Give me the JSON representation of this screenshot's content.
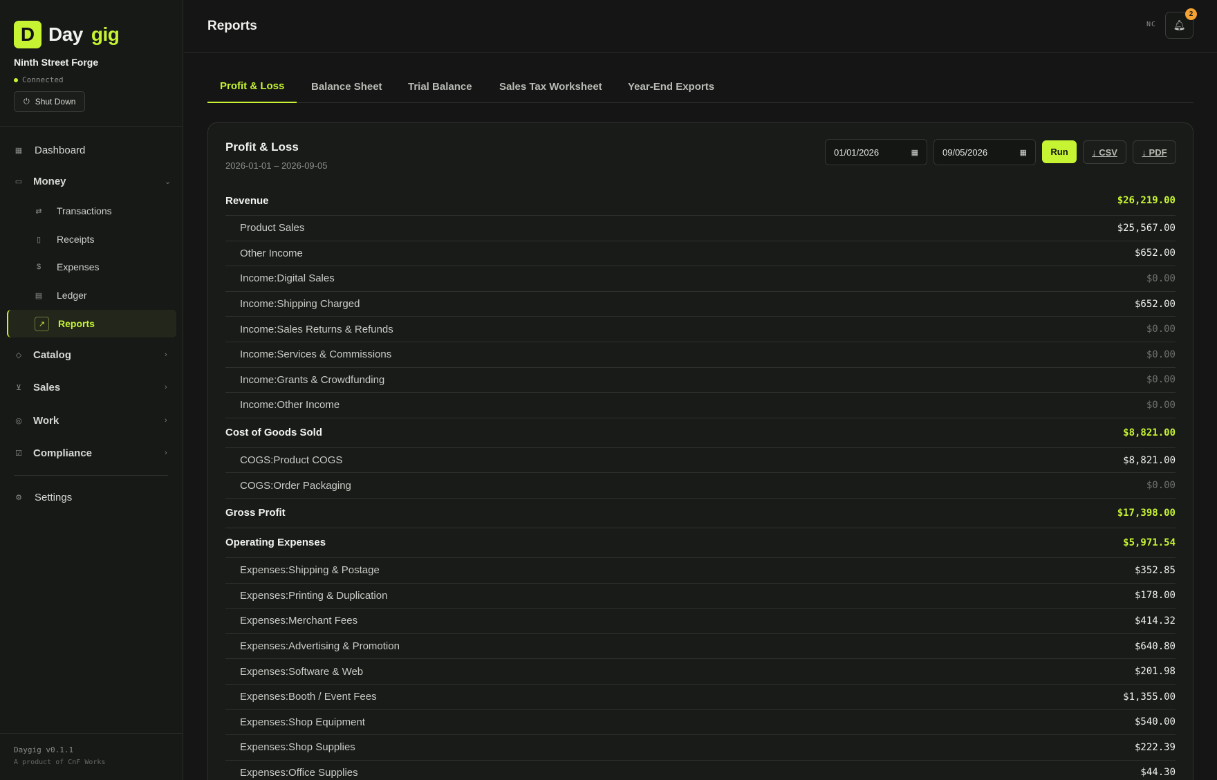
{
  "app": {
    "brand_a": "Day",
    "brand_b": "gig",
    "brand_letter": "D",
    "org_name": "Ninth Street Forge",
    "connection": "Connected",
    "shutdown_label": "Shut Down",
    "version": "Daygig v0.1.1",
    "product_of": "A product of CnF Works",
    "accent_color": "#c6f432"
  },
  "nav": {
    "dashboard": "Dashboard",
    "money": "Money",
    "money_items": [
      "Transactions",
      "Receipts",
      "Expenses",
      "Ledger",
      "Reports"
    ],
    "catalog": "Catalog",
    "sales": "Sales",
    "work": "Work",
    "compliance": "Compliance",
    "settings": "Settings"
  },
  "header": {
    "title": "Reports",
    "user_initials": "NC",
    "notification_count": "2"
  },
  "tabs": [
    "Profit & Loss",
    "Balance Sheet",
    "Trial Balance",
    "Sales Tax Worksheet",
    "Year-End Exports"
  ],
  "report": {
    "title": "Profit & Loss",
    "range": "2026-01-01 – 2026-09-05",
    "start_date": "01/01/2026",
    "end_date": "09/05/2026",
    "run_label": "Run",
    "csv_label": "↓ CSV",
    "pdf_label": "↓ PDF",
    "rows": [
      {
        "kind": "section",
        "name": "Revenue",
        "amount": "$26,219.00"
      },
      {
        "kind": "item",
        "name": "Product Sales",
        "amount": "$25,567.00"
      },
      {
        "kind": "item",
        "name": "Other Income",
        "amount": "$652.00"
      },
      {
        "kind": "item",
        "name": "Income:Digital Sales",
        "amount": "$0.00"
      },
      {
        "kind": "item",
        "name": "Income:Shipping Charged",
        "amount": "$652.00"
      },
      {
        "kind": "item",
        "name": "Income:Sales Returns & Refunds",
        "amount": "$0.00"
      },
      {
        "kind": "item",
        "name": "Income:Services & Commissions",
        "amount": "$0.00"
      },
      {
        "kind": "item",
        "name": "Income:Grants & Crowdfunding",
        "amount": "$0.00"
      },
      {
        "kind": "item",
        "name": "Income:Other Income",
        "amount": "$0.00"
      },
      {
        "kind": "section",
        "name": "Cost of Goods Sold",
        "amount": "$8,821.00"
      },
      {
        "kind": "item",
        "name": "COGS:Product COGS",
        "amount": "$8,821.00"
      },
      {
        "kind": "item",
        "name": "COGS:Order Packaging",
        "amount": "$0.00"
      },
      {
        "kind": "section",
        "name": "Gross Profit",
        "amount": "$17,398.00"
      },
      {
        "kind": "section",
        "name": "Operating Expenses",
        "amount": "$5,971.54"
      },
      {
        "kind": "item",
        "name": "Expenses:Shipping & Postage",
        "amount": "$352.85"
      },
      {
        "kind": "item",
        "name": "Expenses:Printing & Duplication",
        "amount": "$178.00"
      },
      {
        "kind": "item",
        "name": "Expenses:Merchant Fees",
        "amount": "$414.32"
      },
      {
        "kind": "item",
        "name": "Expenses:Advertising & Promotion",
        "amount": "$640.80"
      },
      {
        "kind": "item",
        "name": "Expenses:Software & Web",
        "amount": "$201.98"
      },
      {
        "kind": "item",
        "name": "Expenses:Booth / Event Fees",
        "amount": "$1,355.00"
      },
      {
        "kind": "item",
        "name": "Expenses:Shop Equipment",
        "amount": "$540.00"
      },
      {
        "kind": "item",
        "name": "Expenses:Shop Supplies",
        "amount": "$222.39"
      },
      {
        "kind": "item",
        "name": "Expenses:Office Supplies",
        "amount": "$44.30"
      }
    ]
  }
}
